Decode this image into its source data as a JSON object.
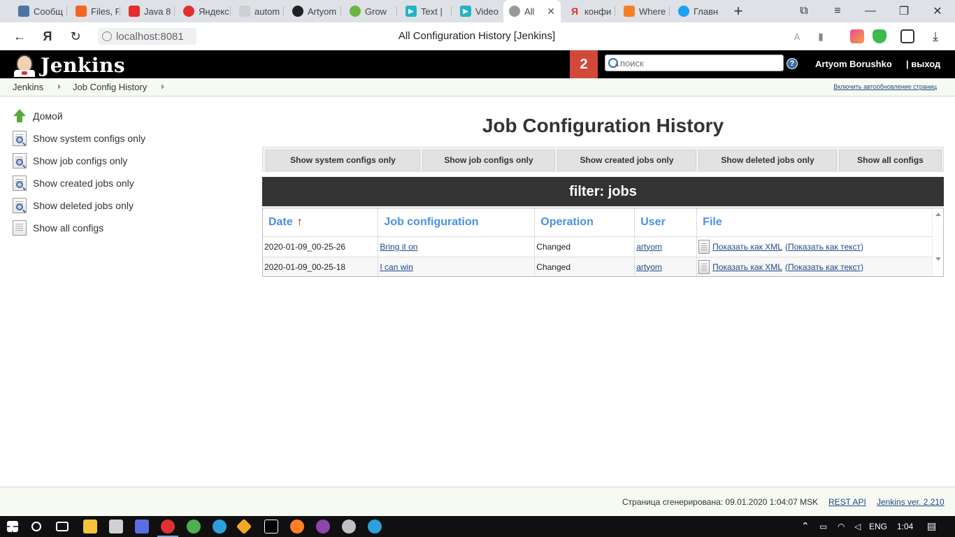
{
  "browser": {
    "tabs": [
      {
        "label": "Сообщ",
        "color": "#4c75a3"
      },
      {
        "label": "Files, F",
        "color": "#f26522"
      },
      {
        "label": "Java 8",
        "color": "#e03030"
      },
      {
        "label": "Яндекс",
        "color": "#e03030"
      },
      {
        "label": "autom",
        "color": "#cfcfcf"
      },
      {
        "label": "Artyom",
        "color": "#222222"
      },
      {
        "label": "Grow",
        "color": "#6db33f"
      },
      {
        "label": "Text | ",
        "color": "#23b3c6"
      },
      {
        "label": "Video",
        "color": "#23b3c6"
      },
      {
        "label": "All",
        "color": "#999999"
      },
      {
        "label": "конфи",
        "color": "#e03030"
      },
      {
        "label": "Where",
        "color": "#f48024"
      },
      {
        "label": "Главн",
        "color": "#1da1f2"
      }
    ],
    "active_tab_index": 9,
    "new_tab_symbol": "+",
    "url_host": "localhost:8081",
    "page_title": "All Configuration History [Jenkins]",
    "yandex_symbol": "Я"
  },
  "jenkins": {
    "logo_text": "Jenkins",
    "notification_count": "2",
    "search_placeholder": "поиск",
    "help_symbol": "?",
    "user_name": "Artyom Borushko",
    "logout_label": "| выход"
  },
  "breadcrumbs": {
    "items": [
      "Jenkins",
      "Job Config History"
    ],
    "autorefresh_label": "Включить автообновление страниц"
  },
  "sidebar": {
    "items": [
      {
        "label": "Домой",
        "icon": "up-arrow-icon"
      },
      {
        "label": "Show system configs only",
        "icon": "document-search-icon"
      },
      {
        "label": "Show job configs only",
        "icon": "document-search-icon"
      },
      {
        "label": "Show created jobs only",
        "icon": "document-search-icon"
      },
      {
        "label": "Show deleted jobs only",
        "icon": "document-search-icon"
      },
      {
        "label": "Show all configs",
        "icon": "document-icon"
      }
    ]
  },
  "main": {
    "title": "Job Configuration History",
    "filter_buttons": [
      "Show system configs only",
      "Show job configs only",
      "Show created jobs only",
      "Show deleted jobs only",
      "Show all configs"
    ],
    "filter_banner": "filter: jobs",
    "table": {
      "columns": [
        "Date",
        "Job configuration",
        "Operation",
        "User",
        "File"
      ],
      "sort_symbol": "↑",
      "rows": [
        {
          "date": "2020-01-09_00-25-26",
          "job": "Bring it on",
          "operation": "Changed",
          "user": "artyom",
          "xml": "Показать как XML",
          "text": "(Показать как текст)"
        },
        {
          "date": "2020-01-09_00-25-18",
          "job": "I can win",
          "operation": "Changed",
          "user": "artyom",
          "xml": "Показать как XML",
          "text": "(Показать как текст)"
        }
      ]
    }
  },
  "footer": {
    "generated": "Страница сгенерирована: 09.01.2020 1:04:07 MSK",
    "rest_api": "REST API",
    "version": "Jenkins ver. 2.210"
  },
  "taskbar": {
    "language": "ENG",
    "time": "1:04"
  }
}
